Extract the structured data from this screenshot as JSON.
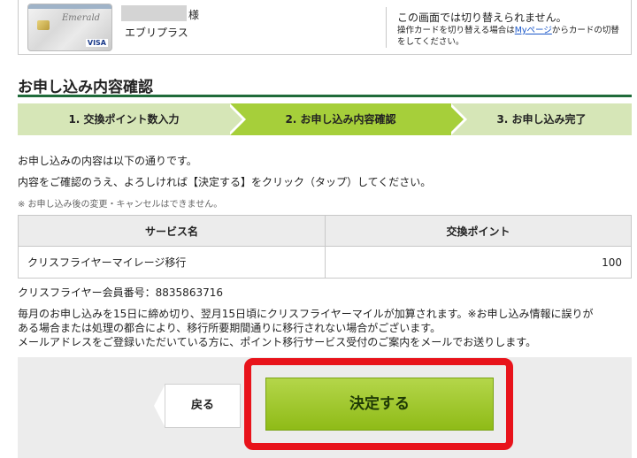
{
  "card": {
    "brand": "Emerald",
    "network": "VISA",
    "honorific": "様",
    "member_type": "エブリプラス"
  },
  "notice": {
    "main": "この画面では切り替えられません。",
    "sub_before": "操作カードを切り替える場合は",
    "sub_link": "Myページ",
    "sub_after": "からカードの切替をしてください。"
  },
  "section_title": "お申し込み内容確認",
  "steps": [
    {
      "label": "1. 交換ポイント数入力",
      "active": false
    },
    {
      "label": "2. お申し込み内容確認",
      "active": true
    },
    {
      "label": "3. お申し込み完了",
      "active": false
    }
  ],
  "intro": {
    "line1": "お申し込みの内容は以下の通りです。",
    "line2": "内容をご確認のうえ、よろしければ【決定する】をクリック（タップ）してください。",
    "note": "※ お申し込み後の変更・キャンセルはできません。"
  },
  "table": {
    "headers": [
      "サービス名",
      "交換ポイント"
    ],
    "rows": [
      {
        "service": "クリスフライヤーマイレージ移行",
        "points": "100"
      }
    ]
  },
  "member_number": "クリスフライヤー会員番号：8835863716",
  "info": {
    "line1": "毎月のお申し込みを15日に締め切り、翌月15日頃にクリスフライヤーマイルが加算されます。※お申し込み情報に誤りが",
    "line2": "ある場合または処理の都合により、移行所要期間通りに移行されない場合がございます。",
    "line3": "メールアドレスをご登録いただいている方に、ポイント移行サービス受付のご案内をメールでお送りします。"
  },
  "buttons": {
    "back": "戻る",
    "submit": "決定する"
  },
  "colors": {
    "accent_green": "#a6cf3a",
    "step_bg": "#d6e6b7",
    "title_rule": "#1f6b3a",
    "highlight_red": "#e8131b"
  }
}
